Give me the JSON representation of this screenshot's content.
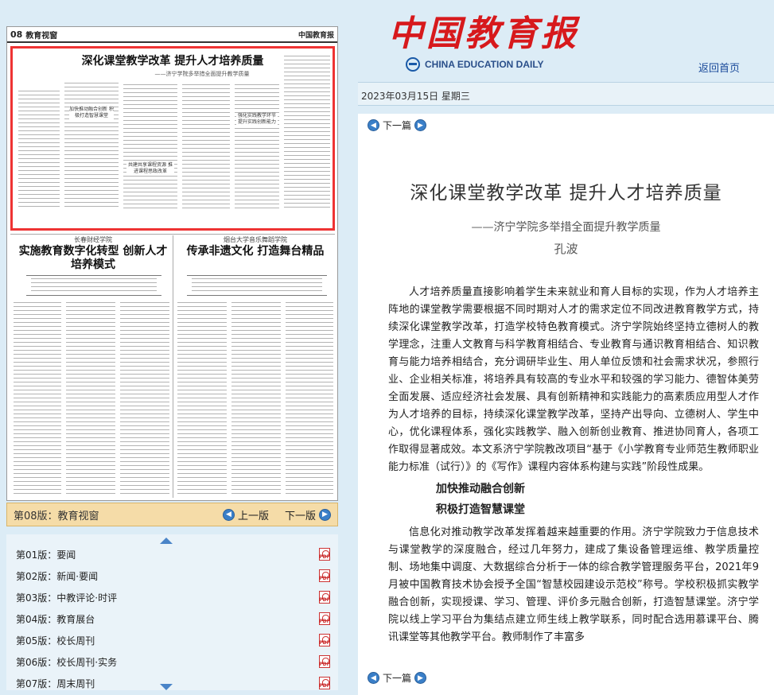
{
  "masthead": {
    "logo_cn": "中国教育报",
    "logo_en": "CHINA EDUCATION DAILY",
    "home_link": "返回首页",
    "date": "2023年03月15日  星期三"
  },
  "paper": {
    "page_no": "08",
    "page_name": "教育视窗",
    "brand": "中国教育报",
    "main_title": "深化课堂教学改革  提升人才培养质量",
    "main_sub": "——济宁学院多举措全面提升教学质量",
    "sub1": "加快推动融合创新 积极打造智慧课堂",
    "sub2": "共建共享课程资源 推进课程思政改革",
    "sub3": "强化实践教学环节 提升实践创新能力",
    "left_kicker": "长春财经学院",
    "left_title": "实施教育数字化转型 创新人才培养模式",
    "right_kicker": "烟台大学音乐舞蹈学院",
    "right_title": "传承非遗文化 打造舞台精品"
  },
  "edition_bar": {
    "current": "第08版：教育视窗",
    "prev": "上一版",
    "next": "下一版"
  },
  "editions": [
    {
      "label": "第01版：要闻"
    },
    {
      "label": "第02版：新闻·要闻"
    },
    {
      "label": "第03版：中教评论·时评"
    },
    {
      "label": "第04版：教育展台"
    },
    {
      "label": "第05版：校长周刊"
    },
    {
      "label": "第06版：校长周刊·实务"
    },
    {
      "label": "第07版：周末周刊"
    }
  ],
  "article": {
    "nav_next": "下一篇",
    "title": "深化课堂教学改革  提升人才培养质量",
    "subtitle": "——济宁学院多举措全面提升教学质量",
    "author": "孔波",
    "p1": "人才培养质量直接影响着学生未来就业和育人目标的实现，作为人才培养主阵地的课堂教学需要根据不同时期对人才的需求定位不同改进教育教学方式，持续深化课堂教学改革，打造学校特色教育模式。济宁学院始终坚持立德树人的教学理念，注重人文教育与科学教育相结合、专业教育与通识教育相结合、知识教育与能力培养相结合，充分调研毕业生、用人单位反馈和社会需求状况，参照行业、企业相关标准，将培养具有较高的专业水平和较强的学习能力、德智体美劳全面发展、适应经济社会发展、具有创新精神和实践能力的高素质应用型人才作为人才培养的目标，持续深化课堂教学改革，坚持产出导向、立德树人、学生中心，优化课程体系，强化实践教学、融入创新创业教育、推进协同育人，各项工作取得显著成效。本文系济宁学院教改项目“基于《小学教育专业师范生教师职业能力标准（试行）》的《写作》课程内容体系构建与实践”阶段性成果。",
    "h1": "加快推动融合创新",
    "h2": "积极打造智慧课堂",
    "p2": "信息化对推动教学改革发挥着越来越重要的作用。济宁学院致力于信息技术与课堂教学的深度融合，经过几年努力，建成了集设备管理运维、教学质量控制、场地集中调度、大数据综合分析于一体的综合教学管理服务平台，2021年9月被中国教育技术协会授予全国“智慧校园建设示范校”称号。学校积极抓实教学融合创新，实现授课、学习、管理、评价多元融合创新，打造智慧课堂。济宁学院以线上学习平台为集结点建立师生线上教学联系，同时配合选用慕课平台、腾讯课堂等其他教学平台。教师制作了丰富多"
  }
}
